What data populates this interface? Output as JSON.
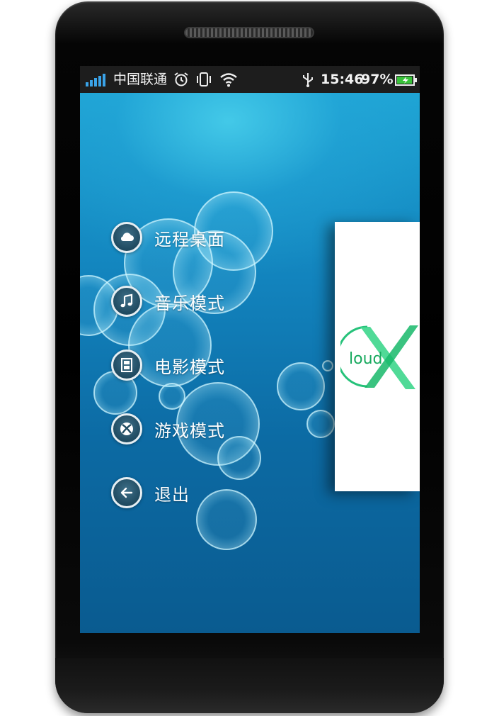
{
  "status_bar": {
    "carrier": "中国联通",
    "time": "15:46",
    "battery_percent": "97%",
    "battery_level": 0.97,
    "icons": [
      "signal-icon",
      "alarm-icon",
      "vibrate-icon",
      "wifi-icon",
      "usb-icon",
      "battery-charging-icon"
    ]
  },
  "menu": {
    "items": [
      {
        "label": "远程桌面",
        "icon": "cloud-icon"
      },
      {
        "label": "音乐模式",
        "icon": "music-note-icon"
      },
      {
        "label": "电影模式",
        "icon": "film-icon"
      },
      {
        "label": "游戏模式",
        "icon": "xbox-icon"
      },
      {
        "label": "退出",
        "icon": "back-arrow-icon"
      }
    ]
  },
  "content_panel": {
    "logo_text": "loud"
  },
  "colors": {
    "accent_green": "#2ecc71",
    "wallpaper_blue": "#1283bd",
    "statusbar": "#1d1d1d"
  }
}
